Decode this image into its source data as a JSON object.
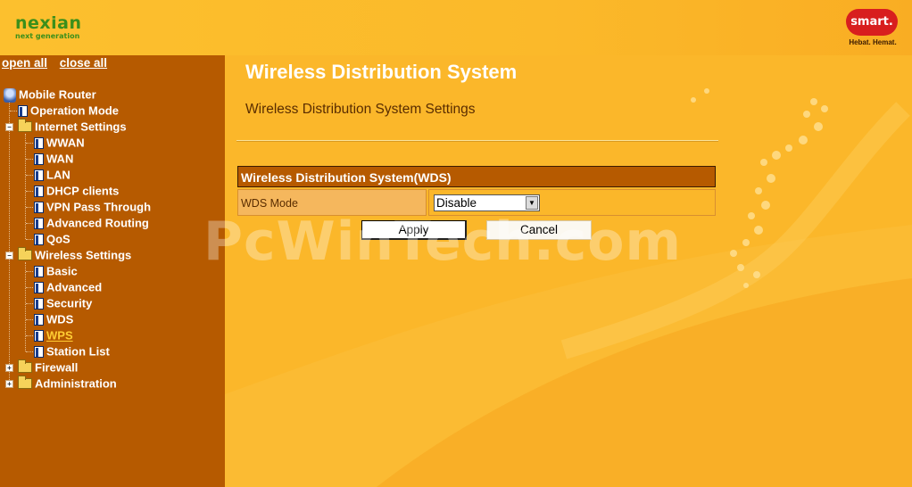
{
  "brand": {
    "name": "nexian",
    "tagline": "next generation"
  },
  "partner": {
    "name": "smart.",
    "tagline": "Hebat. Hemat."
  },
  "sidebar": {
    "open_all": "open all",
    "close_all": "close all",
    "root": "Mobile Router",
    "items": [
      {
        "label": "Operation Mode"
      },
      {
        "label": "Internet Settings",
        "children": [
          "WWAN",
          "WAN",
          "LAN",
          "DHCP clients",
          "VPN Pass Through",
          "Advanced Routing",
          "QoS"
        ]
      },
      {
        "label": "Wireless Settings",
        "children": [
          "Basic",
          "Advanced",
          "Security",
          "WDS",
          "WPS",
          "Station List"
        ]
      },
      {
        "label": "Firewall"
      },
      {
        "label": "Administration"
      }
    ],
    "active_item": "WPS"
  },
  "main": {
    "title": "Wireless Distribution System",
    "subtitle": "Wireless Distribution System Settings",
    "table_header": "Wireless Distribution System(WDS)",
    "mode_label": "WDS Mode",
    "mode_value": "Disable",
    "apply_label": "Apply",
    "cancel_label": "Cancel"
  },
  "watermark": "PcWinTech.com",
  "colors": {
    "sidebar_bg": "#b65a00",
    "page_bg": "#fbb72a",
    "brand_green": "#3b8f1b",
    "partner_red": "#d81e1e"
  }
}
